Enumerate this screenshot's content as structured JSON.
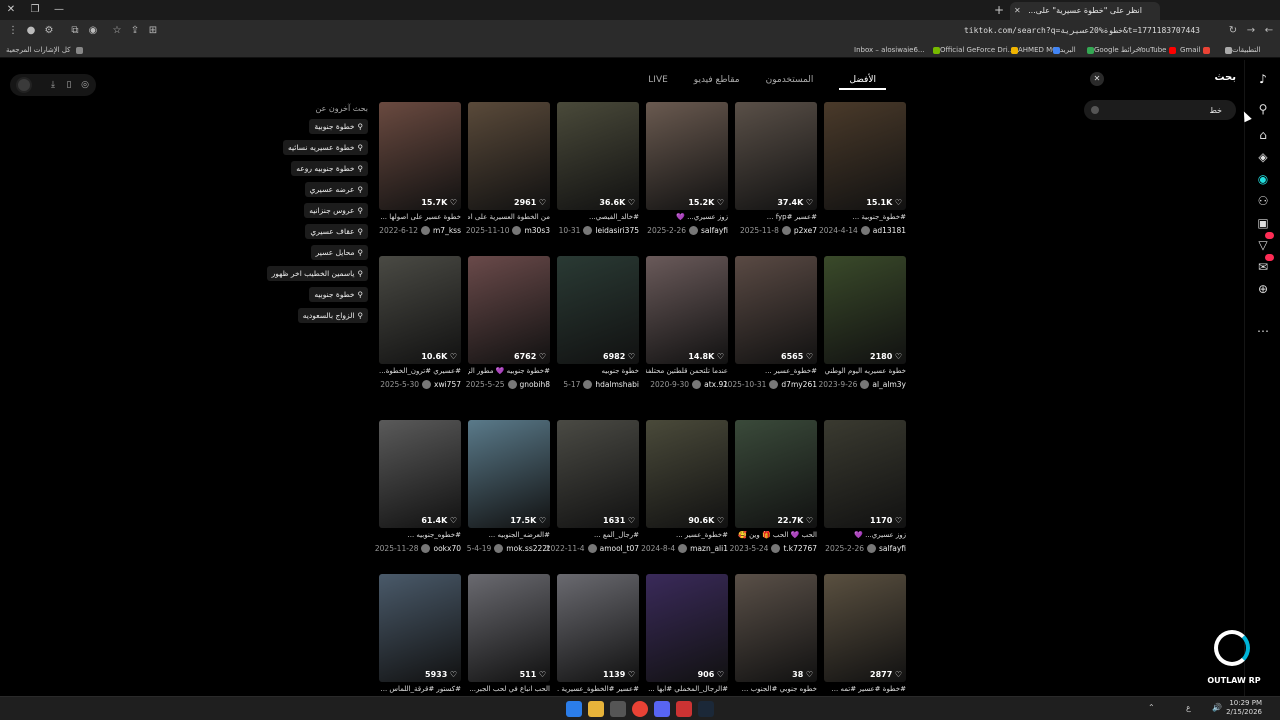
{
  "browser": {
    "tab_title": "انظر على \"خطوة عسيرية\" على...",
    "url": "tiktok.com/search?q=خطوة%20عسيرية&t=1771183707443",
    "bookmarks": [
      "كل الإشارات المرجعية",
      "Inbox – alosiwaie6...",
      "Official GeForce Dri...",
      "AHMED MO...",
      "البريد",
      "Google خرائط",
      "YouTube",
      "Gmail",
      "التطبيقات"
    ]
  },
  "search": {
    "panel_title": "بحث",
    "value": "خط"
  },
  "tabs": [
    {
      "label": "الأفضل",
      "active": true
    },
    {
      "label": "المستخدمون"
    },
    {
      "label": "مقاطع فيديو"
    },
    {
      "label": "LIVE"
    }
  ],
  "related": {
    "title": "بحث آخرون عن",
    "items": [
      "خطوة جنوبية",
      "خطوة عسيريه نسائيه",
      "خطوة جنوبيه روعه",
      "عرضه عسيري",
      "عروس جنزانيه",
      "عقاف عسيري",
      "محايل عسير",
      "ياسمين الخطيب اخر ظهور",
      "خطوة جنوبيه",
      "الزواج بالسعوديه"
    ]
  },
  "videos": [
    {
      "count": "15.1K",
      "caption": "#خطوة_جنوبية ...",
      "user": "ad13181",
      "date": "2024-4-14",
      "color": "#4a3a2a"
    },
    {
      "count": "37.4K",
      "caption": "#عسير #fyp ...",
      "user": "p2xe7",
      "date": "2025-11-8",
      "color": "#5a5048"
    },
    {
      "count": "15.2K",
      "caption": "زوز عسيري... 💜",
      "user": "salfayfi",
      "date": "2025-2-26",
      "color": "#6a5a50"
    },
    {
      "count": "36.6K",
      "caption": "#خالد_الفيصي...",
      "user": "leidasiri375",
      "date": "10-31",
      "color": "#4a4a3a"
    },
    {
      "count": "2961",
      "caption": "من الخطوة العسيرية على اصـ...",
      "user": "m30s3",
      "date": "2025-11-10",
      "color": "#5a4a3a"
    },
    {
      "count": "15.7K",
      "caption": "خطوة عسير على اصولها ...",
      "user": "m7_kss",
      "date": "2022-6-12",
      "color": "#6a4a40"
    },
    {
      "count": "2180",
      "caption": "خطوة عسيريه اليوم الوطني ...",
      "user": "al_alm3y",
      "date": "2023-9-26",
      "color": "#3a4a2a"
    },
    {
      "count": "6565",
      "caption": "#خطوة_عسير ...",
      "user": "d7my261",
      "date": "2025-10-31",
      "color": "#5a4a44"
    },
    {
      "count": "14.8K",
      "caption": "عندما تلتحمن قلطتين محتلفة ...",
      "user": "atx.91",
      "date": "2020-9-30",
      "color": "#6a5a5a"
    },
    {
      "count": "6982",
      "caption": "خطوة جنوبيه",
      "user": "hdalmshabi",
      "date": "5-17",
      "color": "#2a3a34"
    },
    {
      "count": "6762",
      "caption": "#خطوة جنوبيه 💜 مطور الزويحي",
      "user": "gnobih8",
      "date": "2025-5-25",
      "color": "#6a4a4a"
    },
    {
      "count": "10.6K",
      "caption": "#عسيري #ترون_الخطوة...",
      "user": "xwi757",
      "date": "2025-5-30",
      "color": "#4a4a44"
    },
    {
      "count": "1170",
      "caption": "زوز عسيري... 💜",
      "user": "salfayfi",
      "date": "2025-2-26",
      "color": "#3a3a30"
    },
    {
      "count": "22.7K",
      "caption": "الحب 💜 الحب 🎁 وين 🥰",
      "user": "t.k72767",
      "date": "2023-5-24",
      "color": "#3a4a3a"
    },
    {
      "count": "90.6K",
      "caption": "#خطوة_عسير ...",
      "user": "mazn_ali1",
      "date": "2024-8-4",
      "color": "#4a4a3a"
    },
    {
      "count": "1631",
      "caption": "#رجال_ألمع ...",
      "user": "amool_t07",
      "date": "2022-11-4",
      "color": "#4a4a44"
    },
    {
      "count": "17.5K",
      "caption": "#العرضه_الجنوبيه ...",
      "user": "mok.ss222t",
      "date": "5-4-19",
      "color": "#5a7a8a"
    },
    {
      "count": "61.4K",
      "caption": "#خطوه_جنوبيه ...",
      "user": "ookx70",
      "date": "2025-11-28",
      "color": "#5a5a5a"
    },
    {
      "count": "2877",
      "caption": "#خطوة #عسير #تمه ...",
      "user": "",
      "date": "",
      "color": "#5a5040"
    },
    {
      "count": "38",
      "caption": "خطوه جنوبي #الجنوب ...",
      "user": "",
      "date": "",
      "color": "#5a5048"
    },
    {
      "count": "906",
      "caption": "#الرجال_المخملي #ابها ...",
      "user": "",
      "date": "",
      "color": "#3a2a5a"
    },
    {
      "count": "1139",
      "caption": "#عسير #الخطوة_عسيرية ...",
      "user": "",
      "date": "",
      "color": "#6a6a70"
    },
    {
      "count": "511",
      "caption": "الحب انباع في لحب الجبر...",
      "user": "",
      "date": "",
      "color": "#6a6a70"
    },
    {
      "count": "5933",
      "caption": "#كستور #قرقة_اللماس ...",
      "user": "",
      "date": "",
      "color": "#4a5a6a"
    }
  ],
  "taskbar": {
    "time": "10:29 PM",
    "date": "2/15/2026",
    "lang": "ع"
  },
  "watermark": "OUTLAW RP"
}
